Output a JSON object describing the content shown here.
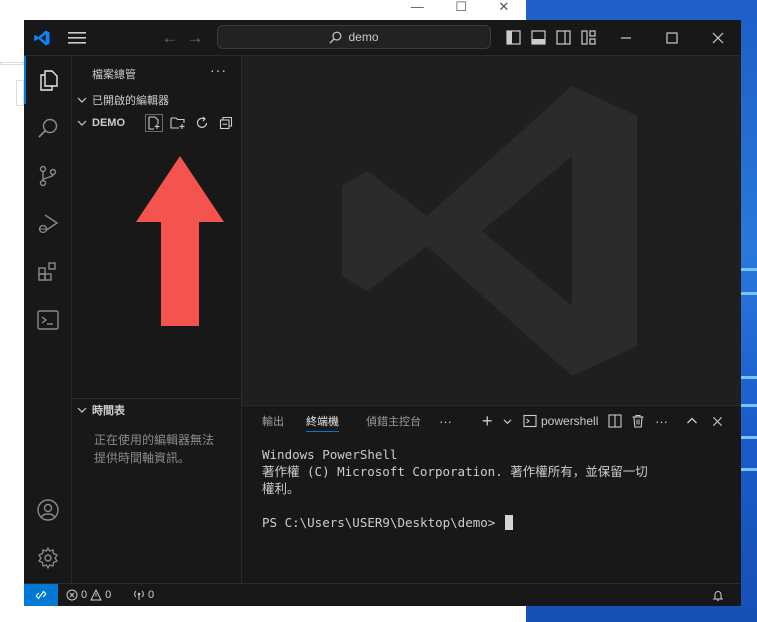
{
  "search": {
    "label": "demo"
  },
  "sidebar": {
    "title": "檔案總管",
    "more": "···",
    "open_editors": "已開啟的編輯器",
    "project": "DEMO",
    "timeline": "時間表",
    "timeline_empty": "正在使用的編輯器無法提供時間軸資訊。"
  },
  "panel": {
    "tabs": [
      {
        "label": "輸出"
      },
      {
        "label": "終端機"
      },
      {
        "label": "偵錯主控台"
      }
    ],
    "more": "···",
    "shell_name": "powershell"
  },
  "terminal": {
    "lines": [
      "Windows PowerShell",
      "著作權 (C) Microsoft Corporation. 著作權所有，並保留一切",
      "權利。",
      "",
      "PS C:\\Users\\USER9\\Desktop\\demo> "
    ]
  },
  "statusbar": {
    "errors": "0",
    "warnings": "0",
    "ports": "0"
  },
  "colors": {
    "accent": "#0078d4",
    "arrow": "#f4534e",
    "background": "#1f1f1f"
  }
}
